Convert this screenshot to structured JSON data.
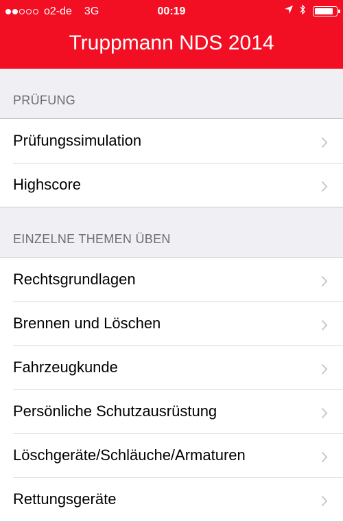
{
  "status_bar": {
    "signal_filled": 2,
    "signal_total": 5,
    "carrier": "o2-de",
    "network": "3G",
    "time": "00:19",
    "icons": [
      "location-arrow-icon",
      "bluetooth-icon",
      "battery-icon"
    ],
    "battery_level_percent": 85
  },
  "nav": {
    "title": "Truppmann NDS 2014",
    "bar_color": "#f20f23"
  },
  "sections": [
    {
      "header": "PRÜFUNG",
      "items": [
        {
          "label": "Prüfungssimulation"
        },
        {
          "label": "Highscore"
        }
      ]
    },
    {
      "header": "EINZELNE THEMEN ÜBEN",
      "items": [
        {
          "label": "Rechtsgrundlagen"
        },
        {
          "label": "Brennen und Löschen"
        },
        {
          "label": "Fahrzeugkunde"
        },
        {
          "label": "Persönliche Schutzausrüstung"
        },
        {
          "label": "Löschgeräte/Schläuche/Armaturen"
        },
        {
          "label": "Rettungsgeräte"
        }
      ]
    }
  ]
}
